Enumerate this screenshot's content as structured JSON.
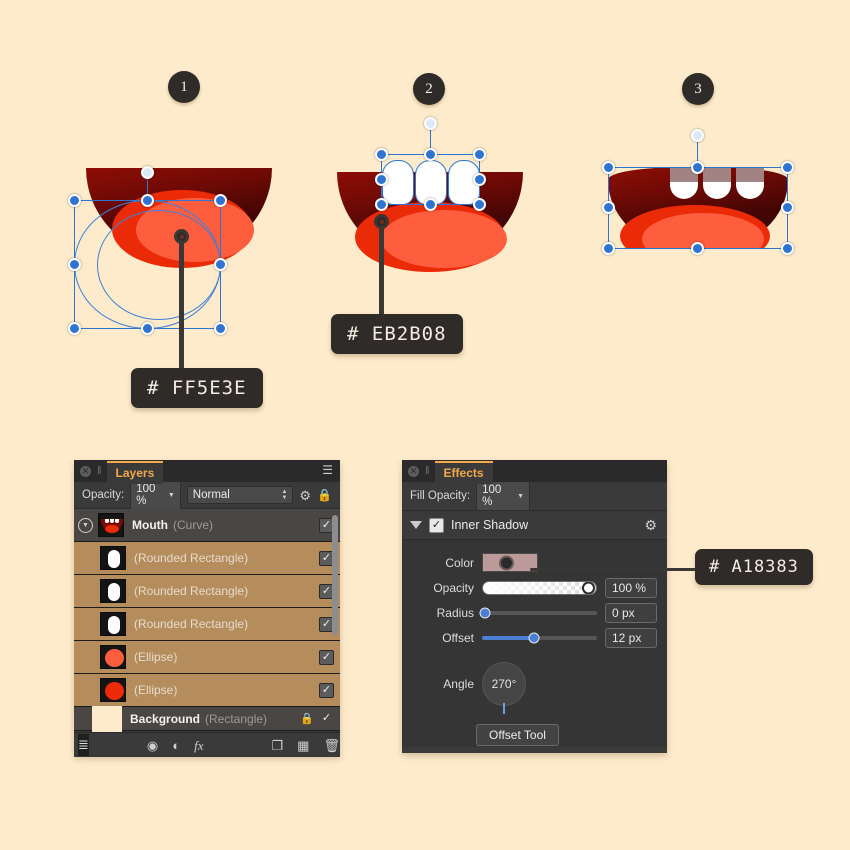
{
  "canvas": {
    "background_color": "#FDEBCB"
  },
  "steps": [
    {
      "number": "1"
    },
    {
      "number": "2"
    },
    {
      "number": "3"
    }
  ],
  "callouts": [
    {
      "id": "tongue-highlight",
      "text": "# FF5E3E"
    },
    {
      "id": "tongue-base",
      "text": "# EB2B08"
    },
    {
      "id": "inner-shadow-color",
      "text": "# A18383"
    }
  ],
  "artwork": {
    "lip_gradient_from": "#8E0D06",
    "lip_gradient_to": "#2B0403",
    "tongue_color": "#EB2B08",
    "tongue_highlight_color": "#FF5E3E",
    "tooth_color": "#FFFFFF",
    "tooth_shadow_color": "#A18383",
    "selection_color": "#2F74D0"
  },
  "layers_panel": {
    "close_glyph": "✕",
    "grip_glyph": "‖",
    "tab_label": "Layers",
    "menu_glyph": "☰",
    "opacity_label": "Opacity:",
    "opacity_value": "100 %",
    "blend_mode": "Normal",
    "gear_icon_glyph": "⚙",
    "lock_icon_glyph": "🔒",
    "rows": [
      {
        "name": "Mouth",
        "type": "(Curve)",
        "kind": "group",
        "visible": "✓",
        "thumb": "mouth"
      },
      {
        "name": "",
        "type": "(Rounded Rectangle)",
        "kind": "child",
        "visible": "✓",
        "thumb": "tooth"
      },
      {
        "name": "",
        "type": "(Rounded Rectangle)",
        "kind": "child",
        "visible": "✓",
        "thumb": "tooth"
      },
      {
        "name": "",
        "type": "(Rounded Rectangle)",
        "kind": "child",
        "visible": "✓",
        "thumb": "tooth"
      },
      {
        "name": "",
        "type": "(Ellipse)",
        "kind": "child",
        "visible": "✓",
        "thumb": "ellipse-light"
      },
      {
        "name": "",
        "type": "(Ellipse)",
        "kind": "child",
        "visible": "✓",
        "thumb": "ellipse-dark"
      },
      {
        "name": "Background",
        "type": "(Rectangle)",
        "kind": "bg",
        "visible": "✓",
        "locked": "🔒",
        "thumb": "cream"
      }
    ],
    "toolbar_icons": [
      {
        "name": "layers-stack-icon",
        "glyph": "≣"
      },
      {
        "name": "mask-icon",
        "glyph": "◉"
      },
      {
        "name": "adjustment-icon",
        "glyph": "◐"
      },
      {
        "name": "fx-icon",
        "glyph": "fx"
      },
      {
        "name": "new-layer-icon",
        "glyph": "❐"
      },
      {
        "name": "new-pixel-layer-icon",
        "glyph": "▦"
      },
      {
        "name": "delete-layer-icon",
        "glyph": "🗑"
      }
    ]
  },
  "effects_panel": {
    "close_glyph": "✕",
    "grip_glyph": "‖",
    "tab_label": "Effects",
    "fill_opacity_label": "Fill Opacity:",
    "fill_opacity_value": "100 %",
    "effect_name": "Inner Shadow",
    "effect_enabled_glyph": "✓",
    "gear_icon_glyph": "⚙",
    "controls": {
      "color_label": "Color",
      "color_value": "#A18383",
      "opacity_label": "Opacity",
      "opacity_value": "100 %",
      "radius_label": "Radius",
      "radius_value": "0 px",
      "offset_label": "Offset",
      "offset_value": "12 px",
      "angle_label": "Angle",
      "angle_value": "270°",
      "offset_tool_label": "Offset Tool"
    }
  }
}
